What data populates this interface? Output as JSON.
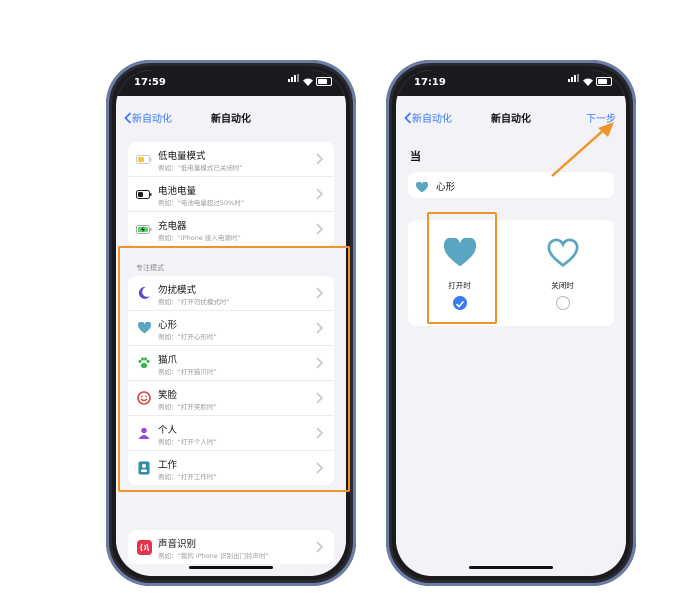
{
  "colors": {
    "accent": "#3b7cf5",
    "highlight": "#f0932b",
    "heart": "#5aa6c2"
  },
  "phone1": {
    "status": {
      "time": "17:59"
    },
    "nav": {
      "back_label": "新自动化",
      "title": "新自动化"
    },
    "battery_group": [
      {
        "title": "低电量模式",
        "subtitle": "例如：“低电量模式已关闭时”",
        "icon": "low-power-battery-icon"
      },
      {
        "title": "电池电量",
        "subtitle": "例如：“电池电量超过50%时”",
        "icon": "battery-level-icon"
      },
      {
        "title": "充电器",
        "subtitle": "例如：“iPhone 接入电源时”",
        "icon": "charger-icon"
      }
    ],
    "focus_label": "专注模式",
    "focus_group": [
      {
        "title": "勿扰模式",
        "subtitle": "例如：“打开勿扰模式时”",
        "icon": "moon-icon"
      },
      {
        "title": "心形",
        "subtitle": "例如：“打开心形时”",
        "icon": "heart-icon"
      },
      {
        "title": "猫爪",
        "subtitle": "例如：“打开猫爪时”",
        "icon": "paw-icon"
      },
      {
        "title": "笑脸",
        "subtitle": "例如：“打开笑脸时”",
        "icon": "smiley-icon"
      },
      {
        "title": "个人",
        "subtitle": "例如：“打开个人时”",
        "icon": "person-icon"
      },
      {
        "title": "工作",
        "subtitle": "例如：“打开工作时”",
        "icon": "work-badge-icon"
      }
    ],
    "sound_group": [
      {
        "title": "声音识别",
        "subtitle": "例如：“我的 iPhone 识别出门铃声时”",
        "icon": "sound-recognition-icon"
      }
    ]
  },
  "phone2": {
    "status": {
      "time": "17:19"
    },
    "nav": {
      "back_label": "新自动化",
      "title": "新自动化",
      "next_label": "下一步"
    },
    "when_label": "当",
    "selected_focus": "心形",
    "options": [
      {
        "label": "打开时",
        "selected": true
      },
      {
        "label": "关闭时",
        "selected": false
      }
    ]
  }
}
